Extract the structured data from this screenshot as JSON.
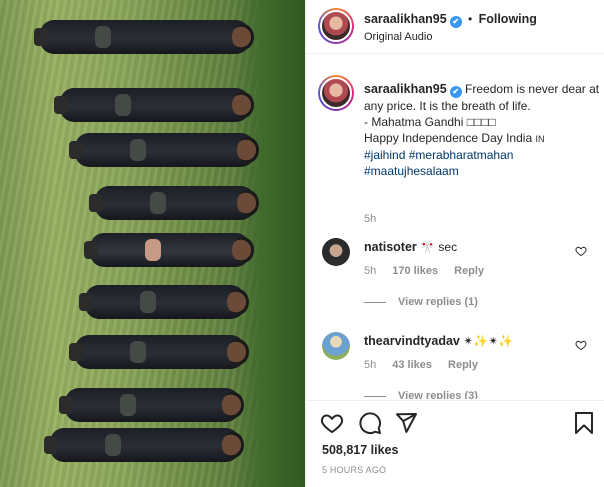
{
  "post": {
    "username": "saraalikhan95",
    "verified_mark": "✔",
    "separator": "•",
    "follow_status": "Following",
    "audio": "Original Audio"
  },
  "caption": {
    "username": "saraalikhan95",
    "text_line1": "Freedom is never dear at any price. It is the breath of life.",
    "text_line2": "- Mahatma Gandhi □□□□",
    "text_line3": "Happy Independence Day India",
    "flag_text": "IN",
    "hashtags": [
      "#jaihind",
      "#merabharatmahan",
      "#maatujhesalaam"
    ],
    "time": "5h"
  },
  "comments": [
    {
      "username": "natisoter",
      "text": "🎌 sec",
      "time": "5h",
      "likes": "170 likes",
      "reply_label": "Reply",
      "view_replies": "View replies (1)"
    },
    {
      "username": "thearvindtyadav",
      "text": "✴✨✴✨",
      "time": "5h",
      "likes": "43 likes",
      "reply_label": "Reply",
      "view_replies": "View replies (3)"
    }
  ],
  "footer": {
    "likes": "508,817 likes",
    "time_ago": "5 HOURS AGO"
  },
  "icons": [
    "heart-icon",
    "comment-icon",
    "share-icon",
    "bookmark-icon",
    "verified-icon"
  ],
  "colors": {
    "link": "#00376b",
    "verified": "#3897f0",
    "muted": "#8e8e8e"
  }
}
